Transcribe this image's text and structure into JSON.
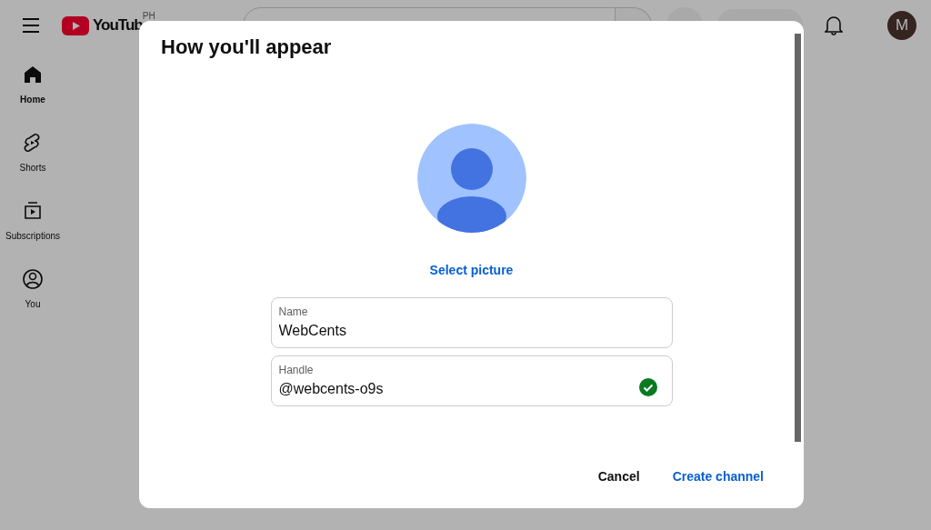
{
  "topbar": {
    "logo_text": "YouTub",
    "region": "PH",
    "avatar_letter": "M"
  },
  "sidebar": {
    "items": [
      {
        "label": "Home",
        "selected": true
      },
      {
        "label": "Shorts",
        "selected": false
      },
      {
        "label": "Subscriptions",
        "selected": false
      },
      {
        "label": "You",
        "selected": false
      }
    ]
  },
  "dialog": {
    "title": "How you'll appear",
    "select_picture": "Select picture",
    "fields": [
      {
        "label": "Name",
        "value": "WebCents",
        "valid": false
      },
      {
        "label": "Handle",
        "value": "@webcents-o9s",
        "valid": true
      }
    ],
    "buttons": [
      {
        "label": "Cancel",
        "kind": "secondary"
      },
      {
        "label": "Create channel",
        "kind": "primary"
      }
    ]
  }
}
